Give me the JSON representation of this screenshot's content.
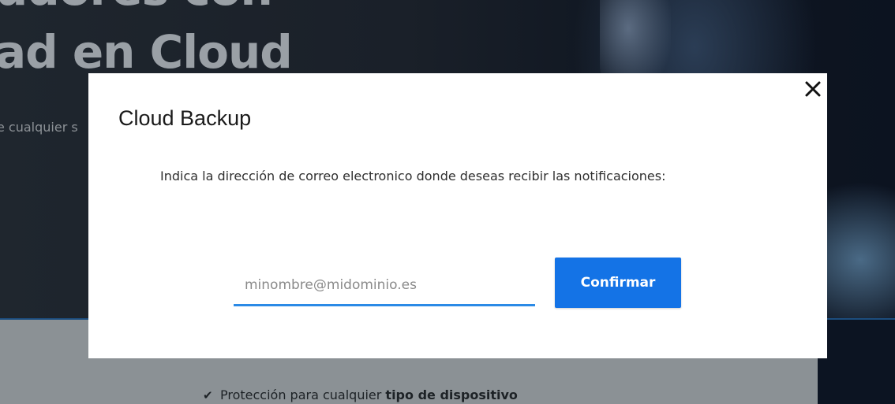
{
  "background": {
    "hero_title_line1": "udores con",
    "hero_title_line2": "ad en Cloud",
    "hero_subtitle": "e cualquier s",
    "feature_item": {
      "icon": "check-icon",
      "text_prefix": "Protección para cualquier ",
      "text_bold": "tipo de dispositivo"
    }
  },
  "modal": {
    "title": "Cloud Backup",
    "description": "Indica la dirección de correo electronico donde deseas recibir las notificaciones:",
    "email_input": {
      "value": "",
      "placeholder": "minombre@midominio.es"
    },
    "confirm_label": "Confirmar",
    "close_icon": "close-icon"
  },
  "colors": {
    "accent": "#1473e6",
    "input_underline": "#2b8ae6"
  }
}
